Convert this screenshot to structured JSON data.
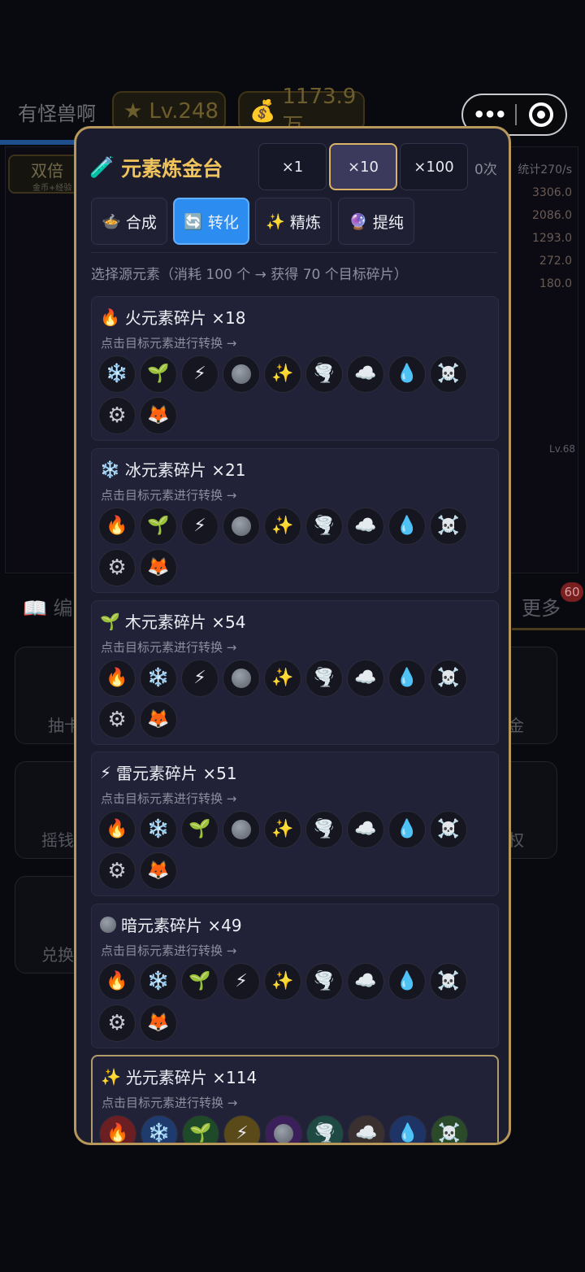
{
  "header": {
    "title": "有怪兽啊",
    "level": "Lv.248",
    "gold": "1173.9万"
  },
  "background": {
    "double_label": "双倍",
    "double_sub": "金币+经验",
    "stat_title": "统计270/s",
    "stat_rows": [
      "3306.0",
      "2086.0",
      "1293.0",
      "272.0",
      "180.0"
    ],
    "edit_label": "编",
    "more_label": "更多",
    "more_badge": "60",
    "right_level": "Lv.68",
    "cards": [
      "抽卡",
      "金",
      "摇钱",
      "权",
      "兑换"
    ]
  },
  "modal": {
    "title": "元素炼金台",
    "multipliers": [
      "×1",
      "×10",
      "×100"
    ],
    "selected_multiplier": "×10",
    "count": "0次",
    "tabs": [
      {
        "label": "合成",
        "icon": "bowl-icon"
      },
      {
        "label": "转化",
        "icon": "cycle-icon"
      },
      {
        "label": "精炼",
        "icon": "sparkles-icon"
      },
      {
        "label": "提纯",
        "icon": "crystal-ball-icon"
      }
    ],
    "active_tab": "转化",
    "hint": "选择源元素（消耗 100 个 → 获得 70 个目标碎片）",
    "sub_hint": "点击目标元素进行转换 →",
    "sources": [
      {
        "name": "火元素碎片 ×18",
        "icon": "🔥"
      },
      {
        "name": "冰元素碎片 ×21",
        "icon": "❄️"
      },
      {
        "name": "木元素碎片 ×54",
        "icon": "🌱"
      },
      {
        "name": "雷元素碎片 ×51",
        "icon": "⚡"
      },
      {
        "name": "暗元素碎片 ×49",
        "icon": "moon"
      },
      {
        "name": "光元素碎片 ×114",
        "icon": "✨"
      }
    ]
  }
}
